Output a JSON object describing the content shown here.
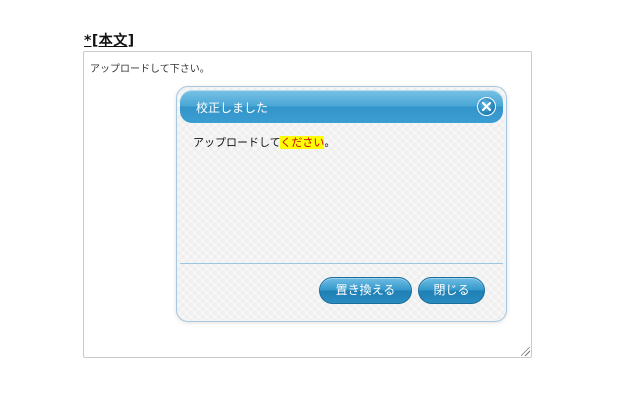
{
  "field": {
    "label": "*[本文]",
    "value": "アップロードして下さい。"
  },
  "dialog": {
    "title": "校正しました",
    "message": {
      "before": "アップロードして",
      "highlight": "ください",
      "after": "。"
    },
    "close_icon": "close-x-icon",
    "buttons": {
      "replace": "置き換える",
      "close": "閉じる"
    }
  },
  "colors": {
    "accent": "#3b9ed2",
    "highlight_bg": "#ffff00",
    "highlight_text": "#cc0000"
  }
}
